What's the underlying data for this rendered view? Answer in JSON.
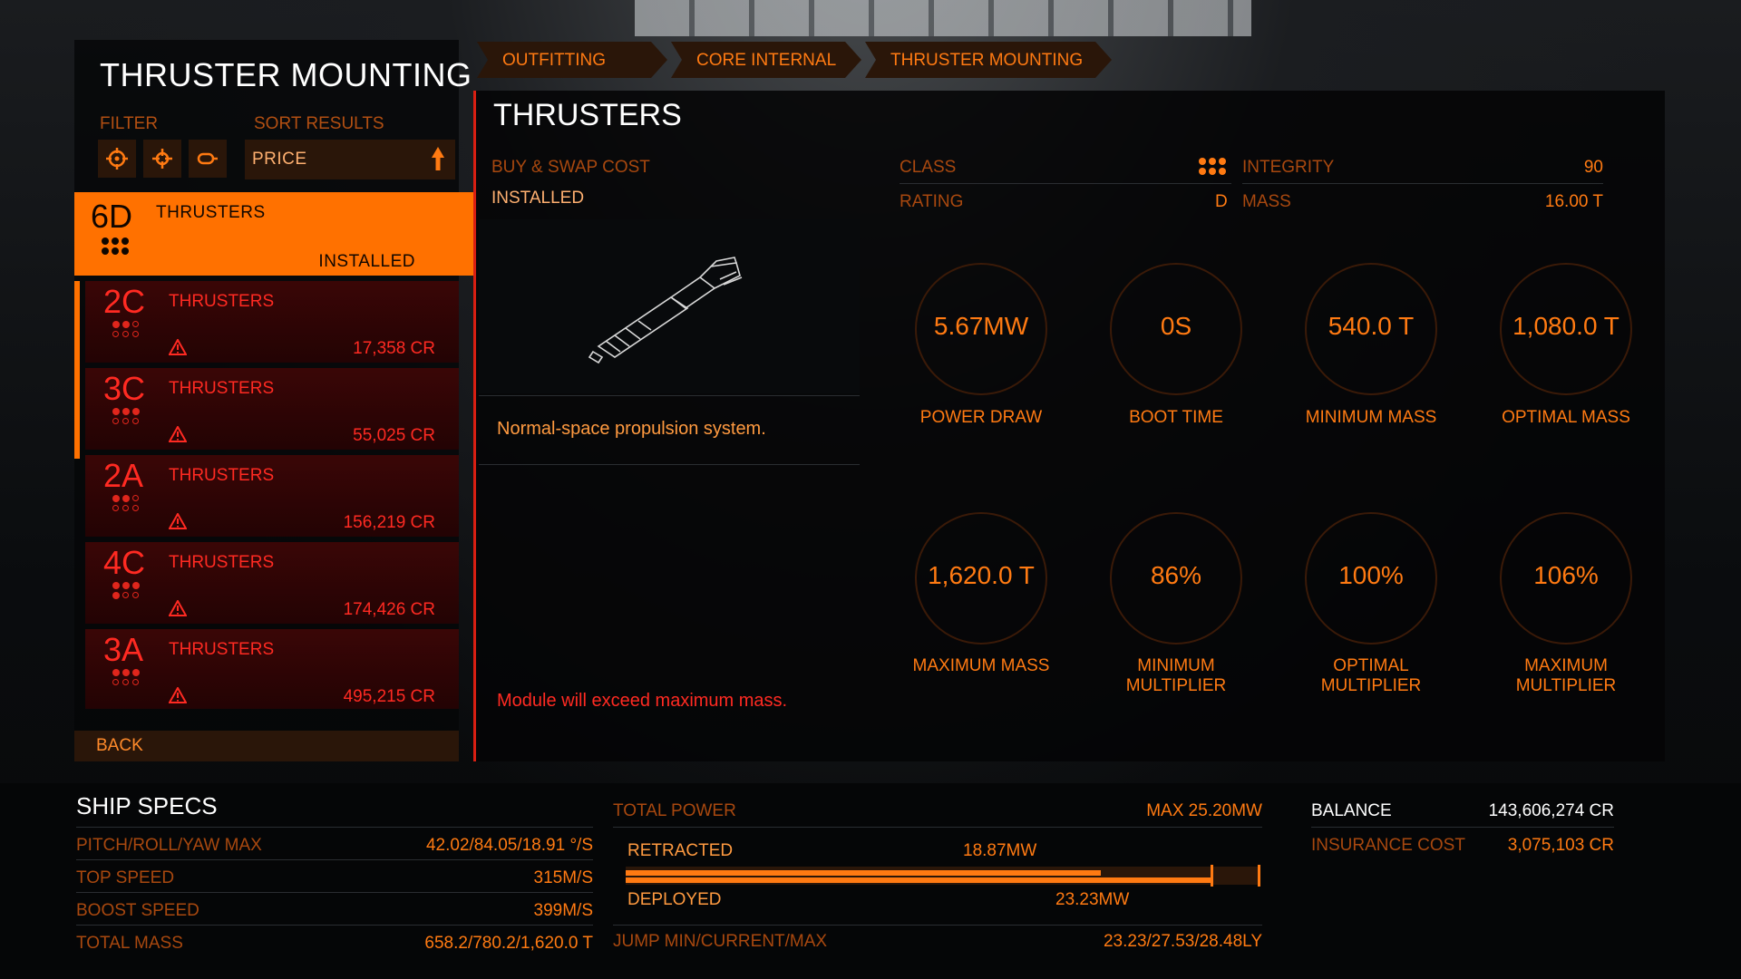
{
  "breadcrumb": [
    "OUTFITTING",
    "CORE INTERNAL",
    "THRUSTER MOUNTING"
  ],
  "left": {
    "title": "THRUSTER MOUNTING",
    "filter_label": "FILTER",
    "sort_label": "SORT RESULTS",
    "filter_icons": [
      "crosshair-icon",
      "target-icon",
      "capsule-icon"
    ],
    "sort_value": "PRICE",
    "selected": {
      "class": "6D",
      "name": "THRUSTERS",
      "status": "INSTALLED"
    },
    "modules": [
      {
        "class": "2C",
        "name": "THRUSTERS",
        "price": "17,358 CR"
      },
      {
        "class": "3C",
        "name": "THRUSTERS",
        "price": "55,025 CR"
      },
      {
        "class": "2A",
        "name": "THRUSTERS",
        "price": "156,219 CR"
      },
      {
        "class": "4C",
        "name": "THRUSTERS",
        "price": "174,426 CR"
      },
      {
        "class": "3A",
        "name": "THRUSTERS",
        "price": "495,215 CR"
      }
    ],
    "back_label": "BACK"
  },
  "detail": {
    "title": "THRUSTERS",
    "buy_swap_label": "BUY & SWAP COST",
    "buy_swap_value": "INSTALLED",
    "class_label": "CLASS",
    "rating_label": "RATING",
    "rating_value": "D",
    "integrity_label": "INTEGRITY",
    "integrity_value": "90",
    "mass_label": "MASS",
    "mass_value": "16.00 T",
    "description": "Normal-space propulsion system.",
    "warning": "Module will exceed maximum mass.",
    "stats": [
      {
        "value": "5.67MW",
        "label": "POWER DRAW"
      },
      {
        "value": "0S",
        "label": "BOOT TIME"
      },
      {
        "value": "540.0 T",
        "label": "MINIMUM MASS"
      },
      {
        "value": "1,080.0 T",
        "label": "OPTIMAL MASS"
      },
      {
        "value": "1,620.0 T",
        "label": "MAXIMUM MASS"
      },
      {
        "value": "86%",
        "label": "MINIMUM MULTIPLIER"
      },
      {
        "value": "100%",
        "label": "OPTIMAL MULTIPLIER"
      },
      {
        "value": "106%",
        "label": "MAXIMUM MULTIPLIER"
      }
    ]
  },
  "specs": {
    "title": "SHIP SPECS",
    "rows": [
      {
        "label": "PITCH/ROLL/YAW MAX",
        "value": "42.02/84.05/18.91 °/S"
      },
      {
        "label": "TOP SPEED",
        "value": "315M/S"
      },
      {
        "label": "BOOST SPEED",
        "value": "399M/S"
      },
      {
        "label": "TOTAL MASS",
        "value": "658.2/780.2/1,620.0 T"
      }
    ]
  },
  "power": {
    "total_label": "TOTAL POWER",
    "max_value": "MAX 25.20MW",
    "retracted_label": "RETRACTED",
    "retracted_value": "18.87MW",
    "deployed_label": "DEPLOYED",
    "deployed_value": "23.23MW",
    "retracted_fraction": 0.749,
    "deployed_fraction": 0.922,
    "jump_label": "JUMP MIN/CURRENT/MAX",
    "jump_value": "23.23/27.53/28.48LY"
  },
  "account": {
    "balance_label": "BALANCE",
    "balance_value": "143,606,274 CR",
    "insurance_label": "INSURANCE COST",
    "insurance_value": "3,075,103 CR"
  },
  "colors": {
    "accent": "#ff7100",
    "warning": "#ff2a22",
    "panel": "#2a1609"
  }
}
